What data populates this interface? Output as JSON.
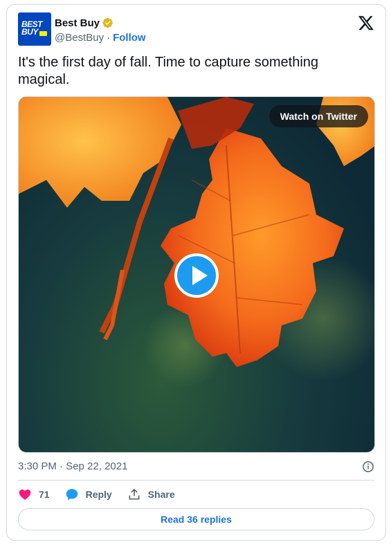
{
  "account": {
    "logo_text": "BEST BUY",
    "name": "Best Buy",
    "handle": "@BestBuy",
    "separator": "·",
    "follow_label": "Follow",
    "verified_color": "#e2b719",
    "brand_color": "#0046be",
    "tag_color": "#fff200"
  },
  "tweet": {
    "text": "It's the first day of fall. Time to capture something magical."
  },
  "media": {
    "watch_label": "Watch on Twitter",
    "play_icon": "play-icon"
  },
  "meta": {
    "timestamp": "3:30 PM · Sep 22, 2021"
  },
  "actions": {
    "like_count": "71",
    "reply_label": "Reply",
    "share_label": "Share"
  },
  "replies": {
    "label": "Read 36 replies"
  },
  "colors": {
    "like": "#f91880",
    "reply": "#1d9bf0",
    "link": "#1d74d8",
    "text_secondary": "#536471",
    "border": "#cfd9de"
  }
}
